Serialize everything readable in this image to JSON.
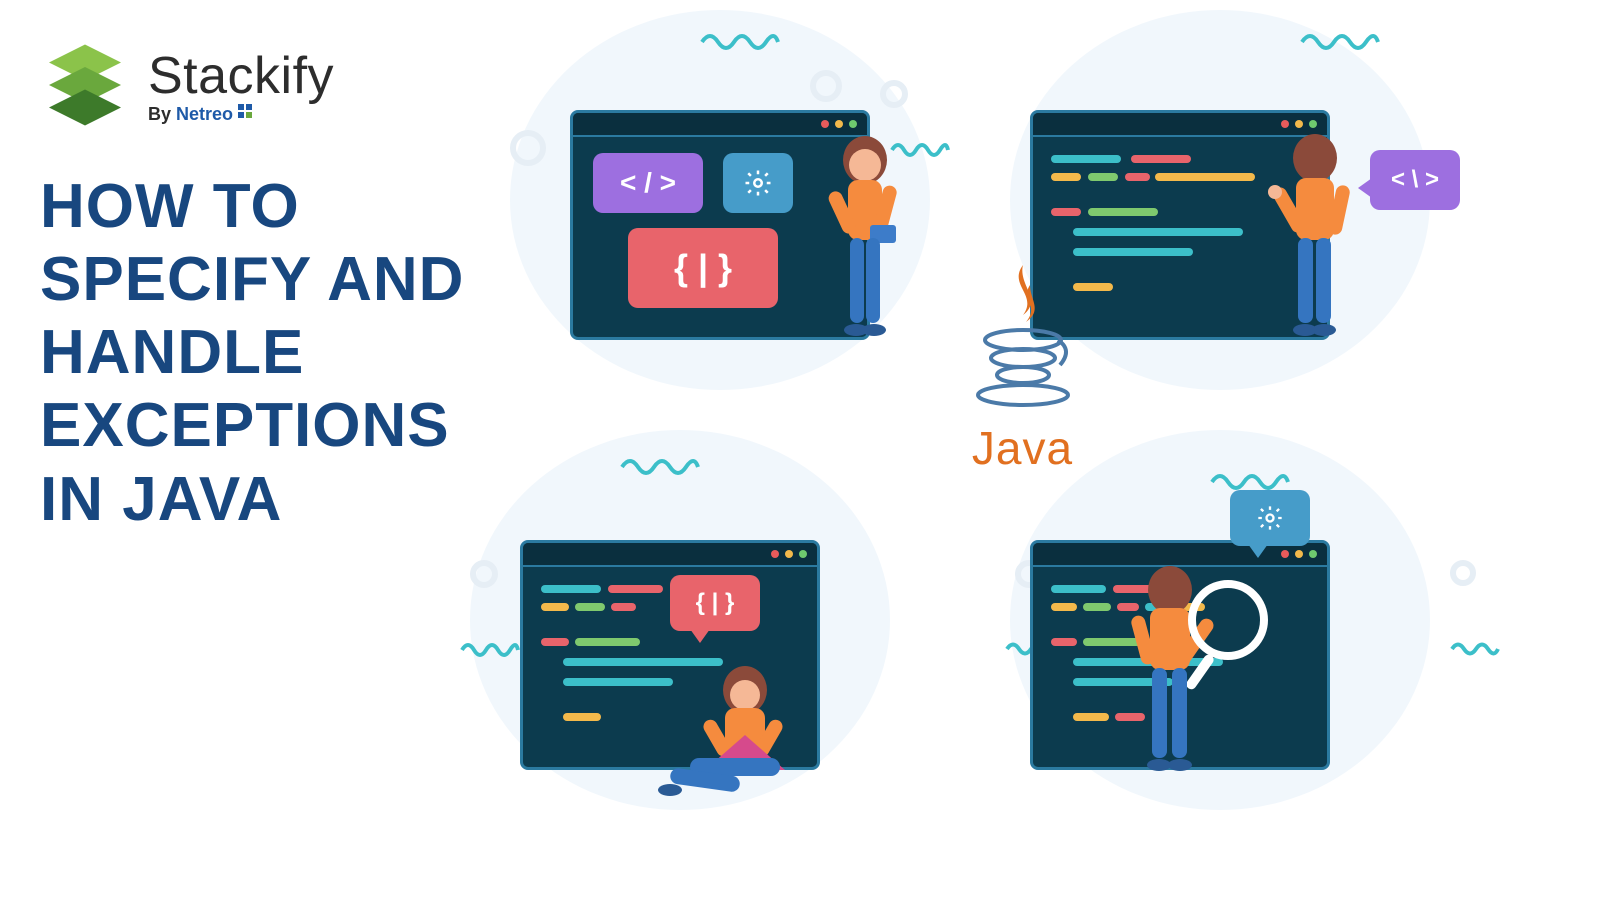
{
  "brand": {
    "name": "Stackify",
    "byline_prefix": "By ",
    "byline_company": "Netreo"
  },
  "title": {
    "l1": "HOW TO",
    "l2": "SPECIFY AND",
    "l3": "HANDLE",
    "l4": "EXCEPTIONS",
    "l5": "IN JAVA"
  },
  "java_label": "Java",
  "symbols": {
    "code_tag": "< / >",
    "braces": "{ | }",
    "code_tag_alt": "< \\ >"
  },
  "colors": {
    "panel": "#0c3b4e",
    "accent_blue": "#3cbfc9",
    "brand_blue": "#18477f",
    "java_orange": "#e17020"
  }
}
